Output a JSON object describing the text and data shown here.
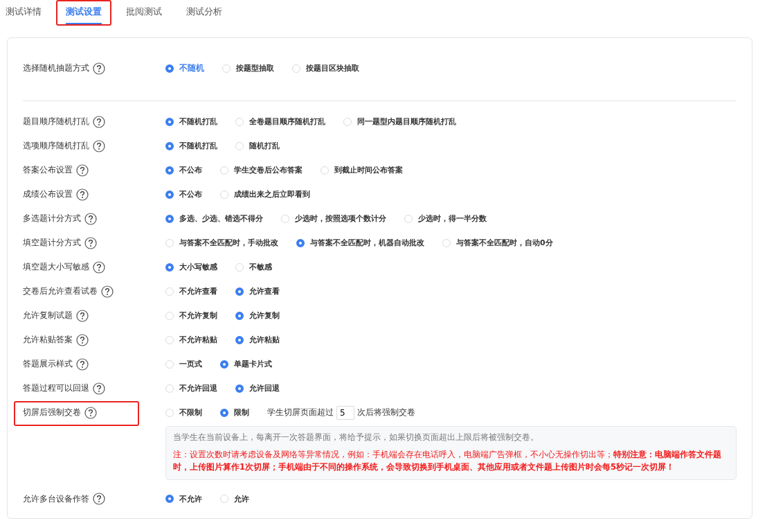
{
  "tabs": [
    {
      "label": "测试详情",
      "selected": false,
      "highlighted": false
    },
    {
      "label": "测试设置",
      "selected": true,
      "highlighted": true
    },
    {
      "label": "批阅测试",
      "selected": false,
      "highlighted": false
    },
    {
      "label": "测试分析",
      "selected": false,
      "highlighted": false
    }
  ],
  "sections": [
    {
      "rows": [
        {
          "kind": "radio",
          "label": "选择随机抽题方式",
          "highlighted": false,
          "options": [
            {
              "label": "不随机",
              "selected": true
            },
            {
              "label": "按题型抽取",
              "selected": false
            },
            {
              "label": "按题目区块抽取",
              "selected": false
            }
          ]
        }
      ]
    },
    {
      "rows": [
        {
          "kind": "radio",
          "label": "题目顺序随机打乱",
          "highlighted": false,
          "options": [
            {
              "label": "不随机打乱",
              "selected": true
            },
            {
              "label": "全卷题目顺序随机打乱",
              "selected": false
            },
            {
              "label": "同一题型内题目顺序随机打乱",
              "selected": false
            }
          ]
        },
        {
          "kind": "radio",
          "label": "选项顺序随机打乱",
          "highlighted": false,
          "options": [
            {
              "label": "不随机打乱",
              "selected": true
            },
            {
              "label": "随机打乱",
              "selected": false
            }
          ]
        },
        {
          "kind": "radio",
          "label": "答案公布设置",
          "highlighted": false,
          "options": [
            {
              "label": "不公布",
              "selected": true
            },
            {
              "label": "学生交卷后公布答案",
              "selected": false
            },
            {
              "label": "到截止时间公布答案",
              "selected": false
            }
          ]
        },
        {
          "kind": "radio",
          "label": "成绩公布设置",
          "highlighted": false,
          "options": [
            {
              "label": "不公布",
              "selected": true
            },
            {
              "label": "成绩出来之后立即看到",
              "selected": false
            }
          ]
        },
        {
          "kind": "radio",
          "label": "多选题计分方式",
          "highlighted": false,
          "options": [
            {
              "label": "多选、少选、错选不得分",
              "selected": true
            },
            {
              "label": "少选时，按照选项个数计分",
              "selected": false
            },
            {
              "label": "少选时，得一半分数",
              "selected": false
            }
          ]
        },
        {
          "kind": "radio",
          "label": "填空题计分方式",
          "highlighted": false,
          "options": [
            {
              "label": "与答案不全匹配时，手动批改",
              "selected": false
            },
            {
              "label": "与答案不全匹配时，机器自动批改",
              "selected": true
            },
            {
              "label": "与答案不全匹配时，自动0分",
              "selected": false
            }
          ]
        },
        {
          "kind": "radio",
          "label": "填空题大小写敏感",
          "highlighted": false,
          "options": [
            {
              "label": "大小写敏感",
              "selected": true
            },
            {
              "label": "不敏感",
              "selected": false
            }
          ]
        },
        {
          "kind": "radio",
          "label": "交卷后允许查看试卷",
          "highlighted": false,
          "options": [
            {
              "label": "不允许查看",
              "selected": false
            },
            {
              "label": "允许查看",
              "selected": true
            }
          ]
        },
        {
          "kind": "radio",
          "label": "允许复制试题",
          "highlighted": false,
          "options": [
            {
              "label": "不允许复制",
              "selected": false
            },
            {
              "label": "允许复制",
              "selected": true
            }
          ]
        },
        {
          "kind": "radio",
          "label": "允许粘贴答案",
          "highlighted": false,
          "options": [
            {
              "label": "不允许粘贴",
              "selected": false
            },
            {
              "label": "允许粘贴",
              "selected": true
            }
          ]
        },
        {
          "kind": "radio",
          "label": "答题展示样式",
          "highlighted": false,
          "options": [
            {
              "label": "一页式",
              "selected": false
            },
            {
              "label": "单题卡片式",
              "selected": true
            }
          ]
        },
        {
          "kind": "radio",
          "label": "答题过程可以回退",
          "highlighted": false,
          "options": [
            {
              "label": "不允许回退",
              "selected": false
            },
            {
              "label": "允许回退",
              "selected": true
            }
          ]
        },
        {
          "kind": "limit",
          "label": "切屏后强制交卷",
          "highlighted": true,
          "options": [
            {
              "label": "不限制",
              "selected": false
            },
            {
              "label": "限制",
              "selected": true
            }
          ],
          "limit_before": "学生切屏页面超过",
          "limit_value": "5",
          "limit_after": "次后将强制交卷",
          "note": "当学生在当前设备上，每离开一次答题界面，将给予提示，如果切换页面超出上限后将被强制交卷。",
          "warning": "注：设置次数时请考虑设备及网络等异常情况，例如：手机端会存在电话呼入，电脑端广告弹框，不小心无操作切出等；**特别注意：电脑端作答文件题时，上传图片算作1次切屏；手机端由于不同的操作系统，会导致切换到手机桌面、其他应用或者文件题上传图片时会每5秒记一次切屏！**"
        },
        {
          "kind": "radio",
          "label": "允许多台设备作答",
          "highlighted": false,
          "options": [
            {
              "label": "不允许",
              "selected": true
            },
            {
              "label": "允许",
              "selected": false
            }
          ]
        }
      ]
    }
  ]
}
